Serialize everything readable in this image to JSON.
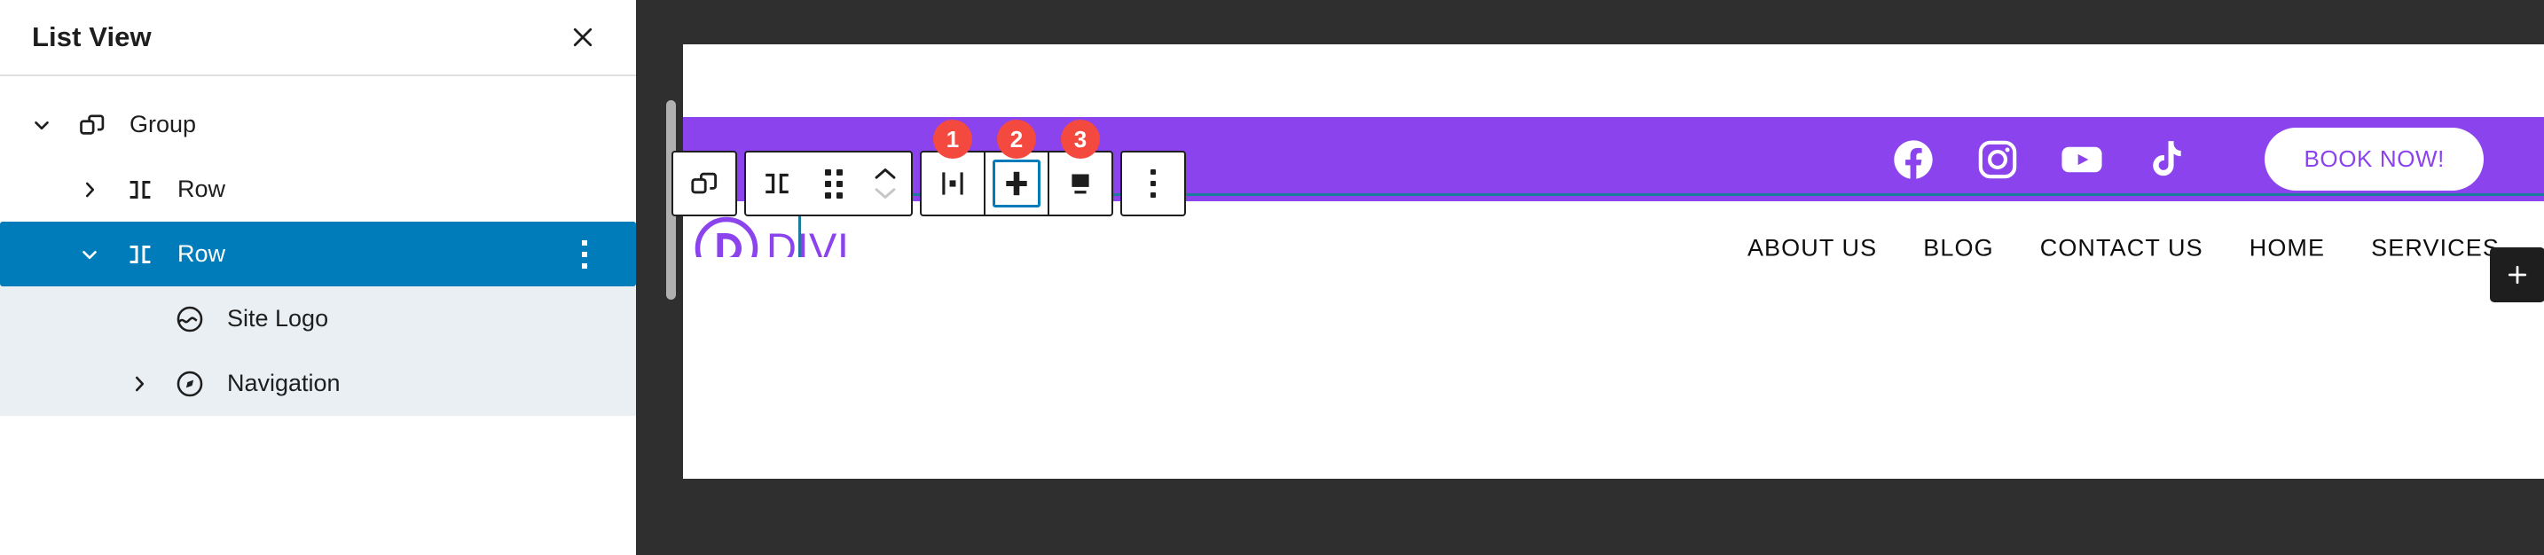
{
  "panel": {
    "title": "List View",
    "close_icon": "close-icon",
    "tree": [
      {
        "label": "Group",
        "icon": "group-icon",
        "indent": 0,
        "chevron": "down",
        "state": "normal",
        "has_menu": false
      },
      {
        "label": "Row",
        "icon": "row-icon",
        "indent": 1,
        "chevron": "right",
        "state": "normal",
        "has_menu": false
      },
      {
        "label": "Row",
        "icon": "row-icon",
        "indent": 1,
        "chevron": "down",
        "state": "selected",
        "has_menu": true
      },
      {
        "label": "Site Logo",
        "icon": "site-logo-icon",
        "indent": 2,
        "chevron": "none",
        "state": "child",
        "has_menu": false
      },
      {
        "label": "Navigation",
        "icon": "navigation-icon",
        "indent": 2,
        "chevron": "right",
        "state": "child",
        "has_menu": false
      }
    ]
  },
  "toolbar": {
    "parent_block_label": "Select parent block: Group",
    "block_type_label": "Row",
    "drag_label": "Drag",
    "move_up_label": "Move up",
    "move_down_label": "Move down",
    "align_buttons": [
      {
        "badge": "1",
        "name": "justify-items-center",
        "label": "Change items justification",
        "selected": false
      },
      {
        "badge": "2",
        "name": "align-vertically",
        "label": "Change vertical alignment",
        "selected": true
      },
      {
        "badge": "3",
        "name": "align-bottom",
        "label": "Align bottom",
        "selected": false
      }
    ],
    "options_label": "Options"
  },
  "canvas": {
    "add_block_label": "+",
    "site": {
      "brand": "DIVI",
      "brand_mark": "D",
      "cta_label": "BOOK NOW!",
      "social": [
        {
          "name": "facebook-icon",
          "label": "Facebook"
        },
        {
          "name": "instagram-icon",
          "label": "Instagram"
        },
        {
          "name": "youtube-icon",
          "label": "YouTube"
        },
        {
          "name": "tiktok-icon",
          "label": "TikTok"
        }
      ],
      "nav": [
        "ABOUT US",
        "BLOG",
        "CONTACT US",
        "HOME",
        "SERVICES"
      ]
    }
  },
  "colors": {
    "selection_blue": "#007cba",
    "outline_blue": "#1a7b9b",
    "brand_purple": "#8b43ed",
    "badge_red": "#f4493f",
    "canvas_dark": "#2f2f2f",
    "child_row": "#e9eff3"
  }
}
